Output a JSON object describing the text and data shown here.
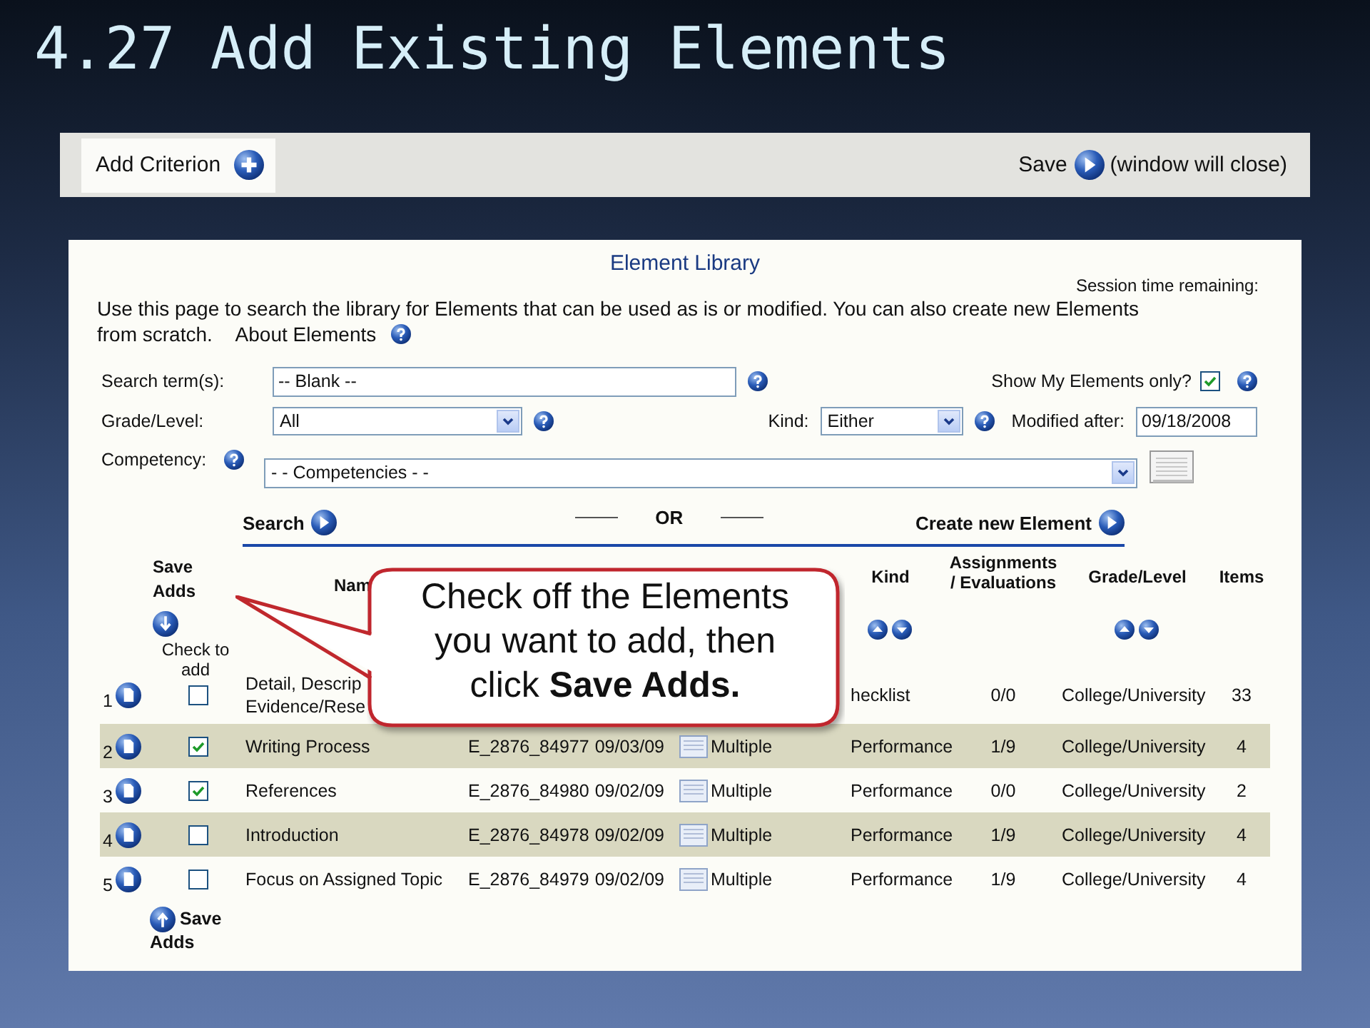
{
  "slide_title": "4.27 Add Existing Elements",
  "toolbar": {
    "add_criterion": "Add Criterion",
    "save": "Save",
    "save_note": "(window will close)"
  },
  "library": {
    "title": "Element Library",
    "session": "Session time remaining:",
    "intro": "Use this page to search the library for Elements that can be used as is or modified.   You can also create new Elements from scratch.",
    "about_link": "About Elements",
    "form": {
      "search_label": "Search term(s):",
      "search_value": "-- Blank --",
      "show_mine_label": "Show My Elements only?",
      "show_mine_checked": true,
      "grade_label": "Grade/Level:",
      "grade_value": "All",
      "kind_label": "Kind:",
      "kind_value": "Either",
      "modified_label": "Modified after:",
      "modified_value": "09/18/2008",
      "competency_label": "Competency:",
      "competency_value": "- - Competencies - -"
    },
    "search": "Search",
    "or": "OR",
    "create": "Create new Element"
  },
  "table": {
    "header": {
      "save_adds": "Save Adds",
      "check_to_add": "Check to add",
      "name": "Nam",
      "kind": "Kind",
      "assignments": "Assignments / Evaluations",
      "grade": "Grade/Level",
      "items": "Items"
    },
    "rows": [
      {
        "num": "1",
        "checked": false,
        "name": "Detail, Descrip\nEvidence/Rese",
        "kind": "hecklist",
        "assignments": "0/0",
        "grade": "College/University",
        "items": "33"
      },
      {
        "num": "2",
        "checked": true,
        "name": "Writing Process",
        "code": "E_2876_84977",
        "date": "09/03/09",
        "type": "Multiple",
        "kind": "Performance",
        "assignments": "1/9",
        "grade": "College/University",
        "items": "4"
      },
      {
        "num": "3",
        "checked": true,
        "name": "References",
        "code": "E_2876_84980",
        "date": "09/02/09",
        "type": "Multiple",
        "kind": "Performance",
        "assignments": "0/0",
        "grade": "College/University",
        "items": "2"
      },
      {
        "num": "4",
        "checked": false,
        "name": "Introduction",
        "code": "E_2876_84978",
        "date": "09/02/09",
        "type": "Multiple",
        "kind": "Performance",
        "assignments": "1/9",
        "grade": "College/University",
        "items": "4"
      },
      {
        "num": "5",
        "checked": false,
        "name": "Focus on Assigned Topic",
        "code": "E_2876_84979",
        "date": "09/02/09",
        "type": "Multiple",
        "kind": "Performance",
        "assignments": "1/9",
        "grade": "College/University",
        "items": "4"
      }
    ],
    "footer_save_adds": "Save Adds"
  },
  "callout": "Check off the Elements\nyou want to add, then\nclick **Save Adds.**"
}
